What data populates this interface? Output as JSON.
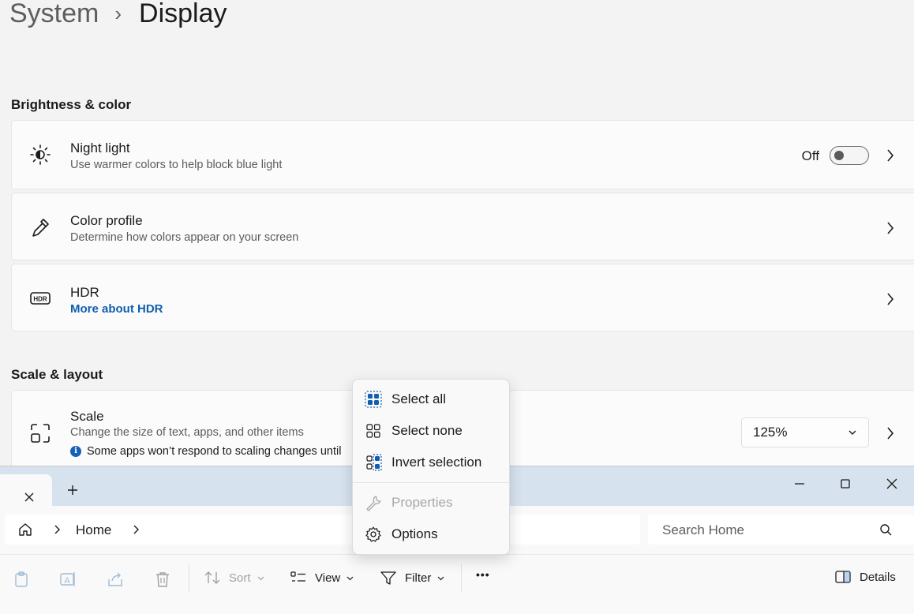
{
  "breadcrumb": {
    "parent": "System",
    "current": "Display"
  },
  "sections": {
    "brightness": "Brightness & color",
    "scale_layout": "Scale & layout"
  },
  "night_light": {
    "title": "Night light",
    "description": "Use warmer colors to help block blue light",
    "state": "Off",
    "icon": "brightness-icon"
  },
  "color_profile": {
    "title": "Color profile",
    "description": "Determine how colors appear on your screen",
    "icon": "eyedropper-icon"
  },
  "hdr": {
    "title": "HDR",
    "link": "More about HDR",
    "icon": "hdr-icon"
  },
  "scale": {
    "title": "Scale",
    "description": "Change the size of text, apps, and other items",
    "info": "Some apps won’t respond to scaling changes until",
    "value": "125%",
    "icon": "scale-icon"
  },
  "explorer": {
    "new_tab": "+",
    "address_root": "Home",
    "search_placeholder": "Search Home",
    "toolbar": {
      "sort": "Sort",
      "view": "View",
      "filter": "Filter",
      "more": "•••",
      "details": "Details"
    }
  },
  "context_menu": {
    "items": [
      {
        "label": "Select all",
        "enabled": true
      },
      {
        "label": "Select none",
        "enabled": true
      },
      {
        "label": "Invert selection",
        "enabled": true
      },
      {
        "label": "Properties",
        "enabled": false
      },
      {
        "label": "Options",
        "enabled": true
      }
    ]
  },
  "colors": {
    "accent": "#0f5fb0",
    "background": "#f3f3f3",
    "card": "#fbfbfb",
    "titlebar": "#d7e2ef"
  }
}
